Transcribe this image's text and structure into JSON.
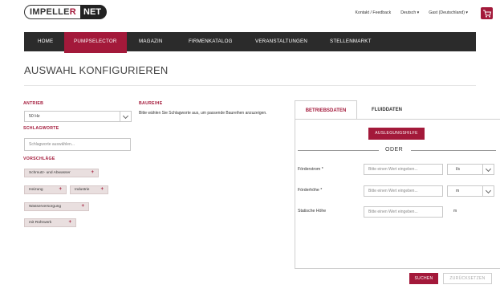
{
  "brand": {
    "part1_prefix": "IMPELLE",
    "part1_accent": "R",
    "part2": "NET",
    "accent_color": "#a3193a",
    "dark_color": "#2b2b2b"
  },
  "toplinks": {
    "contact": "Kontakt / Feedback",
    "language": "Deutsch ▾",
    "user": "Gast (Deutschland) ▾"
  },
  "nav": {
    "items": [
      {
        "label": "HOME"
      },
      {
        "label": "PUMPSELECTOR",
        "active": true
      },
      {
        "label": "MAGAZIN"
      },
      {
        "label": "FIRMENKATALOG"
      },
      {
        "label": "VERANSTALTUNGEN"
      },
      {
        "label": "STELLENMARKT"
      }
    ]
  },
  "page": {
    "title": "AUSWAHL KONFIGURIEREN"
  },
  "left": {
    "antrieb_label": "ANTRIEB",
    "antrieb_value": "50 Hz",
    "schlagworte_label": "SCHLAGWORTE",
    "schlagworte_placeholder": "Schlagworte auswählen...",
    "vorschlaege_label": "VORSCHLÄGE",
    "tags": [
      "Schmutz- und Abwasser",
      "Heizung",
      "Industrie",
      "Wasserversorgung",
      "mit Rührwerk"
    ],
    "tag_plus": "+"
  },
  "baureihe": {
    "label": "BAUREIHE",
    "hint": "Bitte wählen Sie Schlagworte aus, um passende Baureihen anzuzeigen."
  },
  "right": {
    "tabs": [
      {
        "label": "BETRIEBSDATEN",
        "active": true
      },
      {
        "label": "FLUIDDATEN"
      }
    ],
    "auslegungshilfe": "AUSLEGUNGSHILFE",
    "oder": "ODER",
    "foerderstrom_label": "Förderstrom *",
    "foerderstrom_placeholder": "Bitte einen Wert eingeben...",
    "foerderstrom_unit": "l/s",
    "foerderhoehe_label": "Förderhöhe *",
    "foerderhoehe_placeholder": "Bitte einen Wert eingeben...",
    "foerderhoehe_unit": "m",
    "statische_label": "Statische Höhe",
    "statische_placeholder": "Bitte einen Wert eingeben...",
    "statische_unit": "m",
    "suchen": "SUCHEN",
    "zuruecksetzen": "ZURÜCKSETZEN"
  }
}
